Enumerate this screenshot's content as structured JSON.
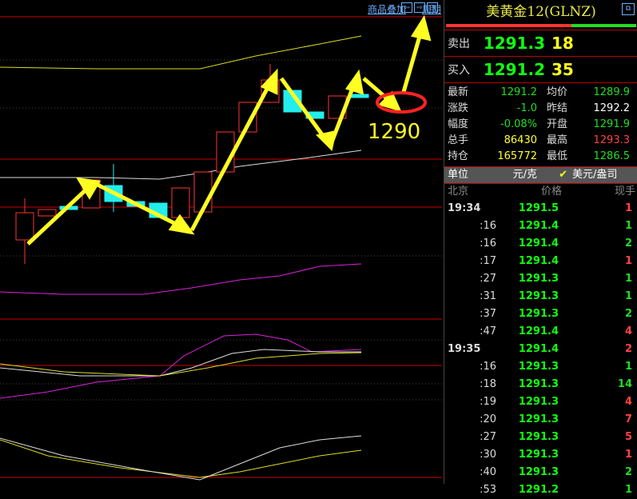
{
  "toolbar": {
    "overlay": "商品叠加",
    "period": "周期",
    "left": "⇦",
    "right": "⇨",
    "layout": "⊟"
  },
  "annotation": {
    "price_label": "1290"
  },
  "panel": {
    "title": "美黄金12(GLNZ)",
    "restore": "⧉",
    "colors": {
      "up": "#ff3333",
      "down": "#22dd22",
      "highlight": "#ffff33"
    },
    "bid_ratio": 0.66,
    "sell": {
      "label": "卖出",
      "price": "1291.3",
      "qty": "18"
    },
    "buy": {
      "label": "买入",
      "price": "1291.2",
      "qty": "35"
    },
    "stats": [
      {
        "l1": "最新",
        "v1": "1291.2",
        "l2": "均价",
        "v2": "1289.9",
        "c1": "#22dd22",
        "c2": "#22dd22"
      },
      {
        "l1": "涨跌",
        "v1": "-1.0",
        "l2": "昨结",
        "v2": "1292.2",
        "c1": "#22dd22",
        "c2": "#ffffff"
      },
      {
        "l1": "幅度",
        "v1": "-0.08%",
        "l2": "开盘",
        "v2": "1291.9",
        "c1": "#22dd22",
        "c2": "#22dd22"
      },
      {
        "l1": "总手",
        "v1": "86430",
        "l2": "最高",
        "v2": "1293.3",
        "c1": "#ffff33",
        "c2": "#ff4444"
      },
      {
        "l1": "持仓",
        "v1": "165772",
        "l2": "最低",
        "v2": "1286.5",
        "c1": "#ffff33",
        "c2": "#22dd22"
      }
    ],
    "unit": {
      "label": "单位",
      "opt1": "元/克",
      "check": "✔",
      "opt2": "美元/盎司"
    },
    "thead": {
      "time": "北京",
      "price": "价格",
      "vol": "现手"
    },
    "ticks": [
      {
        "t": "19:34",
        "p": "1291.5",
        "v": "1",
        "c": "#ff4444",
        "big": true
      },
      {
        "t": ":16",
        "p": "1291.4",
        "v": "1",
        "c": "#22dd22"
      },
      {
        "t": ":16",
        "p": "1291.4",
        "v": "2",
        "c": "#22dd22"
      },
      {
        "t": ":17",
        "p": "1291.4",
        "v": "1",
        "c": "#ff4444"
      },
      {
        "t": ":27",
        "p": "1291.3",
        "v": "1",
        "c": "#22dd22"
      },
      {
        "t": ":31",
        "p": "1291.3",
        "v": "1",
        "c": "#22dd22"
      },
      {
        "t": ":37",
        "p": "1291.3",
        "v": "2",
        "c": "#22dd22"
      },
      {
        "t": ":47",
        "p": "1291.4",
        "v": "4",
        "c": "#ff4444"
      },
      {
        "t": "19:35",
        "p": "1291.4",
        "v": "2",
        "c": "#ff4444",
        "big": true
      },
      {
        "t": ":16",
        "p": "1291.3",
        "v": "1",
        "c": "#22dd22"
      },
      {
        "t": ":18",
        "p": "1291.3",
        "v": "14",
        "c": "#22dd22"
      },
      {
        "t": ":19",
        "p": "1291.3",
        "v": "4",
        "c": "#ff4444"
      },
      {
        "t": ":20",
        "p": "1291.3",
        "v": "7",
        "c": "#ff4444"
      },
      {
        "t": ":27",
        "p": "1291.3",
        "v": "5",
        "c": "#ff4444"
      },
      {
        "t": ":30",
        "p": "1291.3",
        "v": "1",
        "c": "#ff4444"
      },
      {
        "t": ":40",
        "p": "1291.3",
        "v": "2",
        "c": "#22dd22"
      },
      {
        "t": ":53",
        "p": "1291.2",
        "v": "1",
        "c": "#22dd22"
      }
    ]
  }
}
